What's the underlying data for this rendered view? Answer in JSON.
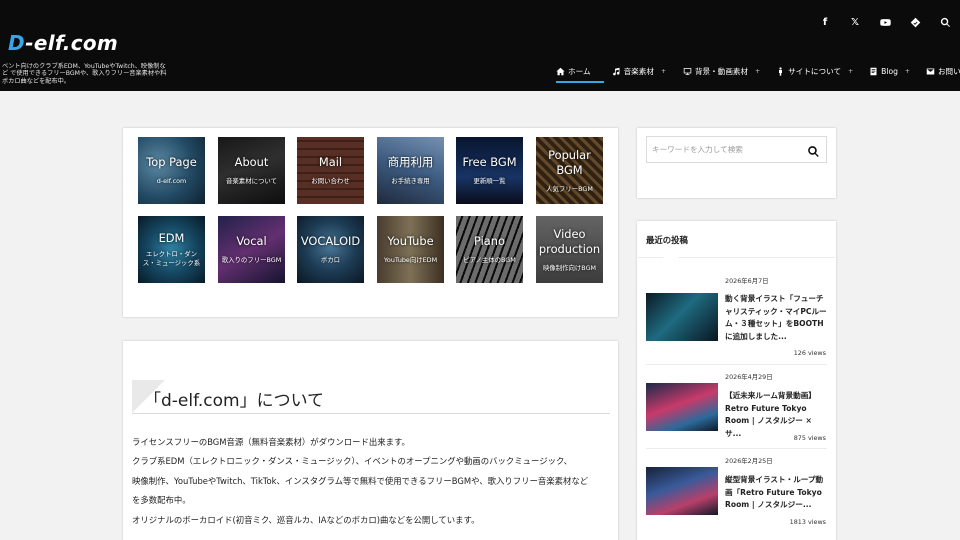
{
  "site": {
    "logo_d": "D",
    "logo_rest": "-elf.com",
    "tagline": "ベント向けのクラブ系EDM、YouTubeやTwitch、映像制など で使用できるフリーBGMや、歌入りフリー音楽素材や料ボカロ曲などを配布中。"
  },
  "social": [
    {
      "icon": "facebook-icon",
      "glyph": "f"
    },
    {
      "icon": "x-twitter-icon",
      "glyph": "𝕏"
    },
    {
      "icon": "youtube-icon"
    },
    {
      "icon": "feedly-icon"
    },
    {
      "icon": "search-icon"
    }
  ],
  "nav": [
    {
      "label": "ホーム",
      "icon": "home-icon",
      "active": true
    },
    {
      "label": "音楽素材",
      "icon": "music-note-icon",
      "chevron": "+"
    },
    {
      "label": "背景・動画素材",
      "icon": "monitor-icon",
      "chevron": "+"
    },
    {
      "label": "サイトについて",
      "icon": "person-icon",
      "chevron": "+"
    },
    {
      "label": "Blog",
      "icon": "document-icon",
      "chevron": "+"
    },
    {
      "label": "お問い合わせ",
      "icon": "envelope-icon"
    }
  ],
  "tiles": [
    {
      "title": "Top Page",
      "sub": "d-elf.com"
    },
    {
      "title": "About",
      "sub": "音楽素材について"
    },
    {
      "title": "Mail",
      "sub": "お問い合わせ"
    },
    {
      "title": "商用利用",
      "sub": "お手続き専用"
    },
    {
      "title": "Free BGM",
      "sub": "更新順一覧"
    },
    {
      "title": "Popular BGM",
      "sub": "人気フリーBGM"
    },
    {
      "title": "EDM",
      "sub": "エレクトロ・ダンス・ミュージック系"
    },
    {
      "title": "Vocal",
      "sub": "歌入りのフリーBGM"
    },
    {
      "title": "VOCALOID",
      "sub": "ボカロ"
    },
    {
      "title": "YouTube",
      "sub": "YouTube向けEDM"
    },
    {
      "title": "Piano",
      "sub": "ピアノ主体のBGM"
    },
    {
      "title": "Video production",
      "sub": "映像制作向けBGM"
    }
  ],
  "search": {
    "placeholder": "キーワードを入力して検索"
  },
  "recent": {
    "title": "最近の投稿",
    "posts": [
      {
        "date": "2026年6月7日",
        "title": "動く背景イラスト「フューチャリスティック・マイPCルーム・３種セット」をBOOTHに追加しました...",
        "views": "126 views"
      },
      {
        "date": "2026年4月29日",
        "title": "【近未来ルーム背景動画】Retro Future Tokyo Room | ノスタルジー × サ...",
        "views": "875 views"
      },
      {
        "date": "2026年2月25日",
        "title": "縦型背景イラスト・ループ動画「Retro Future Tokyo Room | ノスタルジー...",
        "views": "1813 views"
      }
    ]
  },
  "about": {
    "heading": "「d-elf.com」について",
    "lines": [
      "ライセンスフリーのBGM音源（無料音楽素材）がダウンロード出来ます。",
      "クラブ系EDM（エレクトロニック・ダンス・ミュージック）、イベントのオープニングや動画のバックミュージック、",
      "映像制作、YouTubeやTwitch、TikTok、インスタグラム等で無料で使用できるフリーBGMや、歌入りフリー音楽素材など",
      "を多数配布中。",
      "オリジナルのボーカロイド(初音ミク、巡音ルカ、IAなどのボカロ)曲などを公開しています。"
    ]
  },
  "colors": {
    "header_bg": "#0b0b0b",
    "accent": "#37a6e6",
    "page_bg": "#f2f2f2"
  }
}
